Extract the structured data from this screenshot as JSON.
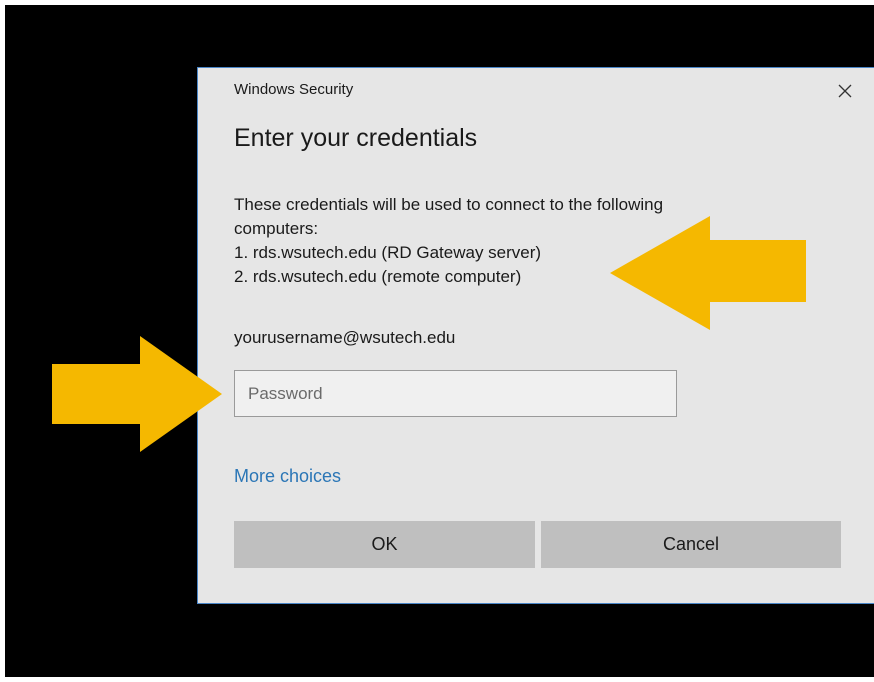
{
  "dialog": {
    "app_title": "Windows Security",
    "heading": "Enter your credentials",
    "description_lines": [
      "These credentials will be used to connect to the following",
      "computers:",
      "1. rds.wsutech.edu (RD Gateway server)",
      "2. rds.wsutech.edu (remote computer)"
    ],
    "username": "yourusername@wsutech.edu",
    "password": {
      "placeholder": "Password",
      "value": ""
    },
    "more_choices_label": "More choices",
    "ok_label": "OK",
    "cancel_label": "Cancel",
    "close_icon": "close-icon"
  },
  "annotations": {
    "arrow_color": "#f5b800",
    "arrows": [
      {
        "name": "arrow-pointing-right",
        "points_to": "password-input"
      },
      {
        "name": "arrow-pointing-left",
        "points_to": "computer-list"
      }
    ]
  },
  "colors": {
    "dialog_background": "#e6e6e6",
    "dialog_border": "#4a86c8",
    "link": "#2b76b6",
    "button": "#bfbfbf",
    "backdrop": "#000000"
  }
}
